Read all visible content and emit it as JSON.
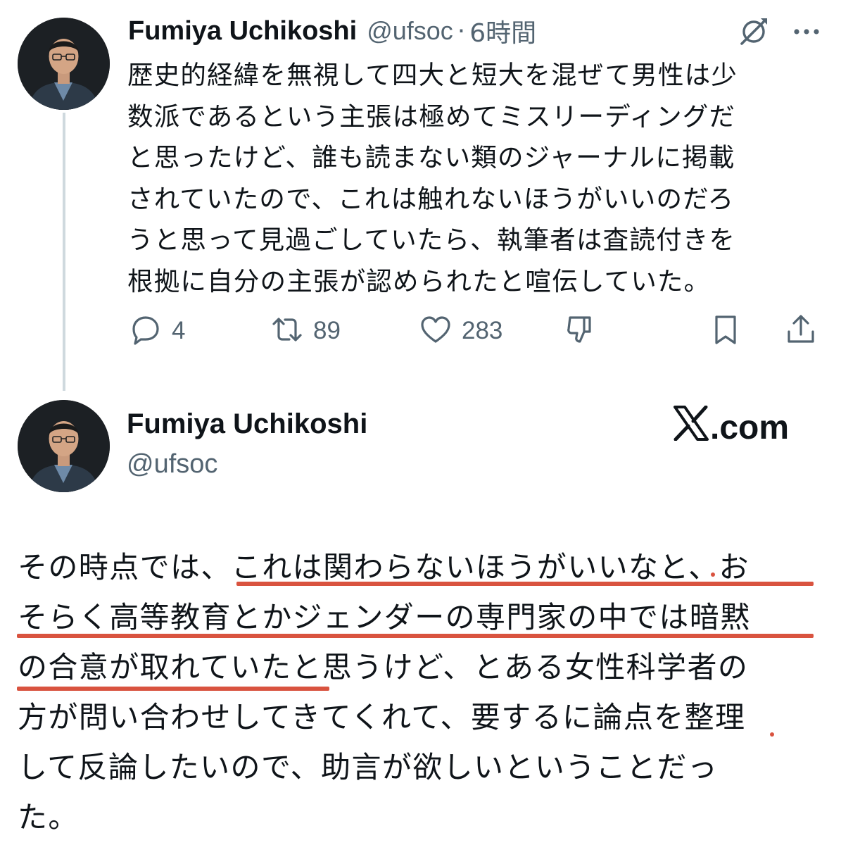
{
  "tweet1": {
    "author_name": "Fumiya Uchikoshi",
    "handle": "@ufsoc",
    "separator": "·",
    "time": "6時間",
    "body_lines": [
      "歴史的経緯を無視して四大と短大を混ぜて男性は少",
      "数派であるという主張は極めてミスリーディングだ",
      "と思ったけど、誰も読まない類のジャーナルに掲載",
      "されていたので、これは触れないほうがいいのだろ",
      "うと思って見過ごしていたら、執筆者は査読付きを",
      "根拠に自分の主張が認められたと喧伝していた。"
    ],
    "replies": "4",
    "retweets": "89",
    "likes": "283",
    "icons": {
      "top_right": [
        "grok-icon",
        "more-icon"
      ],
      "actions": [
        "reply-icon",
        "retweet-icon",
        "like-icon",
        "downvote-icon",
        "bookmark-icon",
        "share-icon"
      ]
    }
  },
  "tweet2": {
    "author_name": "Fumiya Uchikoshi",
    "handle": "@ufsoc",
    "site": ".com",
    "site_logo": "x-logo-icon",
    "body_lines": [
      "その時点では、これは関わらないほうがいいなと、お",
      "そらく高等教育とかジェンダーの専門家の中では暗黙",
      "の合意が取れていたと思うけど、とある女性科学者の",
      "方が問い合わせしてきてくれて、要するに論点を整理",
      "して反論したいので、助言が欲しいということだっ",
      "た。"
    ]
  },
  "colors": {
    "text": "#0f1419",
    "secondary": "#536471",
    "thread_line": "#cfd9de",
    "underline": "#d9533f"
  }
}
